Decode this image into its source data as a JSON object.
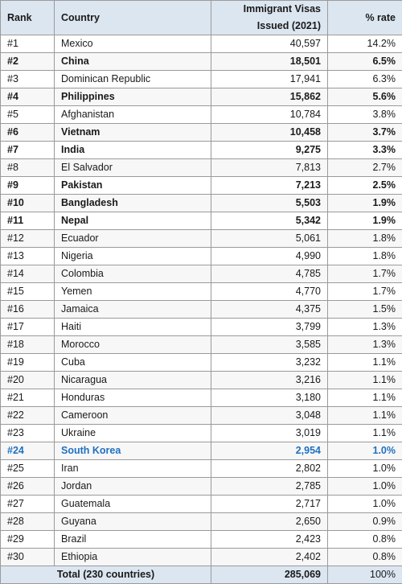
{
  "table": {
    "columns": [
      {
        "key": "rank",
        "label": "Rank"
      },
      {
        "key": "country",
        "label": "Country"
      },
      {
        "key": "visas",
        "label": "Immigrant Visas Issued (2021)"
      },
      {
        "key": "rate",
        "label": "% rate"
      }
    ],
    "header": {
      "rank": "Rank",
      "country": "Country",
      "visas_line1": "Immigrant Visas",
      "visas_line2": "Issued (2021)",
      "rate": "% rate"
    },
    "rows": [
      {
        "rank": "#1",
        "country": "Mexico",
        "visas": "40,597",
        "rate": "14.2%",
        "style": "normal"
      },
      {
        "rank": "#2",
        "country": "China",
        "visas": "18,501",
        "rate": "6.5%",
        "style": "bold"
      },
      {
        "rank": "#3",
        "country": "Dominican Republic",
        "visas": "17,941",
        "rate": "6.3%",
        "style": "normal"
      },
      {
        "rank": "#4",
        "country": "Philippines",
        "visas": "15,862",
        "rate": "5.6%",
        "style": "bold"
      },
      {
        "rank": "#5",
        "country": "Afghanistan",
        "visas": "10,784",
        "rate": "3.8%",
        "style": "normal"
      },
      {
        "rank": "#6",
        "country": "Vietnam",
        "visas": "10,458",
        "rate": "3.7%",
        "style": "bold"
      },
      {
        "rank": "#7",
        "country": "India",
        "visas": "9,275",
        "rate": "3.3%",
        "style": "bold"
      },
      {
        "rank": "#8",
        "country": "El Salvador",
        "visas": "7,813",
        "rate": "2.7%",
        "style": "normal"
      },
      {
        "rank": "#9",
        "country": "Pakistan",
        "visas": "7,213",
        "rate": "2.5%",
        "style": "bold"
      },
      {
        "rank": "#10",
        "country": "Bangladesh",
        "visas": "5,503",
        "rate": "1.9%",
        "style": "bold"
      },
      {
        "rank": "#11",
        "country": "Nepal",
        "visas": "5,342",
        "rate": "1.9%",
        "style": "bold"
      },
      {
        "rank": "#12",
        "country": "Ecuador",
        "visas": "5,061",
        "rate": "1.8%",
        "style": "normal"
      },
      {
        "rank": "#13",
        "country": "Nigeria",
        "visas": "4,990",
        "rate": "1.8%",
        "style": "normal"
      },
      {
        "rank": "#14",
        "country": "Colombia",
        "visas": "4,785",
        "rate": "1.7%",
        "style": "normal"
      },
      {
        "rank": "#15",
        "country": "Yemen",
        "visas": "4,770",
        "rate": "1.7%",
        "style": "normal"
      },
      {
        "rank": "#16",
        "country": "Jamaica",
        "visas": "4,375",
        "rate": "1.5%",
        "style": "normal"
      },
      {
        "rank": "#17",
        "country": "Haiti",
        "visas": "3,799",
        "rate": "1.3%",
        "style": "normal-indent"
      },
      {
        "rank": "#18",
        "country": "Morocco",
        "visas": "3,585",
        "rate": "1.3%",
        "style": "normal"
      },
      {
        "rank": "#19",
        "country": "Cuba",
        "visas": "3,232",
        "rate": "1.1%",
        "style": "normal"
      },
      {
        "rank": "#20",
        "country": "Nicaragua",
        "visas": "3,216",
        "rate": "1.1%",
        "style": "normal"
      },
      {
        "rank": "#21",
        "country": "Honduras",
        "visas": "3,180",
        "rate": "1.1%",
        "style": "normal"
      },
      {
        "rank": "#22",
        "country": "Cameroon",
        "visas": "3,048",
        "rate": "1.1%",
        "style": "normal"
      },
      {
        "rank": "#23",
        "country": "Ukraine",
        "visas": "3,019",
        "rate": "1.1%",
        "style": "normal"
      },
      {
        "rank": "#24",
        "country": "South Korea",
        "visas": "2,954",
        "rate": "1.0%",
        "style": "accent"
      },
      {
        "rank": "#25",
        "country": "Iran",
        "visas": "2,802",
        "rate": "1.0%",
        "style": "normal"
      },
      {
        "rank": "#26",
        "country": "Jordan",
        "visas": "2,785",
        "rate": "1.0%",
        "style": "normal"
      },
      {
        "rank": "#27",
        "country": "Guatemala",
        "visas": "2,717",
        "rate": "1.0%",
        "style": "normal"
      },
      {
        "rank": "#28",
        "country": "Guyana",
        "visas": "2,650",
        "rate": "0.9%",
        "style": "normal"
      },
      {
        "rank": "#29",
        "country": "Brazil",
        "visas": "2,423",
        "rate": "0.8%",
        "style": "normal"
      },
      {
        "rank": "#30",
        "country": "Ethiopia",
        "visas": "2,402",
        "rate": "0.8%",
        "style": "normal"
      }
    ],
    "total": {
      "label": "Total (230 countries)",
      "visas": "285,069",
      "rate": "100%"
    }
  },
  "colors": {
    "header_bg": "#dce6f1",
    "total_bg": "#dce6f1",
    "stripe_bg": "#f7f7f7",
    "row_bg": "#ffffff",
    "border": "#9a9a9a",
    "text": "#1a1a1a",
    "accent": "#1f70c1"
  },
  "chart_data": {
    "type": "table",
    "title": "Immigrant Visas Issued (2021) by Country",
    "columns": [
      "Rank",
      "Country",
      "Immigrant Visas Issued (2021)",
      "% rate"
    ],
    "categories": [
      "Mexico",
      "China",
      "Dominican Republic",
      "Philippines",
      "Afghanistan",
      "Vietnam",
      "India",
      "El Salvador",
      "Pakistan",
      "Bangladesh",
      "Nepal",
      "Ecuador",
      "Nigeria",
      "Colombia",
      "Yemen",
      "Jamaica",
      "Haiti",
      "Morocco",
      "Cuba",
      "Nicaragua",
      "Honduras",
      "Cameroon",
      "Ukraine",
      "South Korea",
      "Iran",
      "Jordan",
      "Guatemala",
      "Guyana",
      "Brazil",
      "Ethiopia"
    ],
    "series": [
      {
        "name": "Immigrant Visas Issued (2021)",
        "values": [
          40597,
          18501,
          17941,
          15862,
          10784,
          10458,
          9275,
          7813,
          7213,
          5503,
          5342,
          5061,
          4990,
          4785,
          4770,
          4375,
          3799,
          3585,
          3232,
          3216,
          3180,
          3048,
          3019,
          2954,
          2802,
          2785,
          2717,
          2650,
          2423,
          2402
        ]
      },
      {
        "name": "% rate",
        "values": [
          14.2,
          6.5,
          6.3,
          5.6,
          3.8,
          3.7,
          3.3,
          2.7,
          2.5,
          1.9,
          1.9,
          1.8,
          1.8,
          1.7,
          1.7,
          1.5,
          1.3,
          1.3,
          1.1,
          1.1,
          1.1,
          1.1,
          1.1,
          1.0,
          1.0,
          1.0,
          1.0,
          0.9,
          0.8,
          0.8
        ]
      }
    ],
    "total": {
      "label": "Total (230 countries)",
      "visas": 285069,
      "rate": "100%"
    },
    "highlighted": [
      "South Korea"
    ],
    "emphasized": [
      "China",
      "Philippines",
      "Vietnam",
      "India",
      "Pakistan",
      "Bangladesh",
      "Nepal"
    ],
    "xlabel": "Country",
    "ylabel": "Immigrant Visas Issued (2021)"
  }
}
